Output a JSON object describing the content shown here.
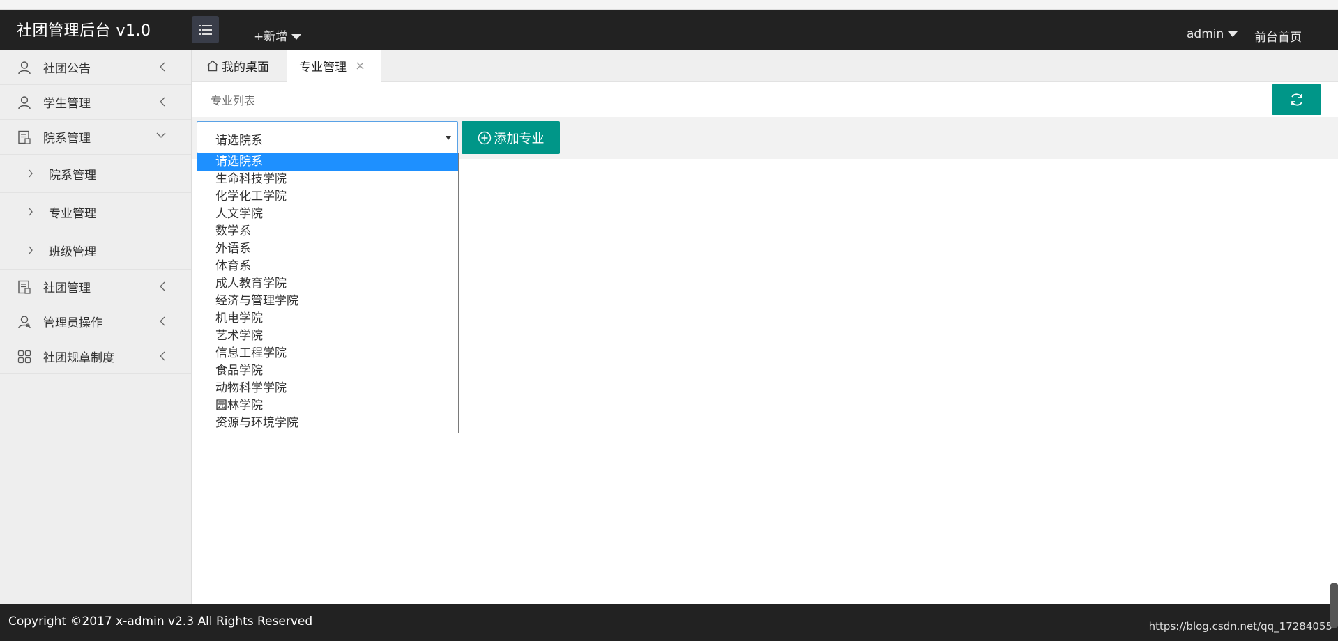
{
  "header": {
    "logo": "社团管理后台 v1.0",
    "add_new": "+新增",
    "user": "admin",
    "front_home": "前台首页"
  },
  "sidebar": {
    "items": [
      {
        "label": "社团公告",
        "icon": "user-icon"
      },
      {
        "label": "学生管理",
        "icon": "user-icon"
      },
      {
        "label": "院系管理",
        "icon": "document-icon"
      },
      {
        "label": "社团管理",
        "icon": "document-icon"
      },
      {
        "label": "管理员操作",
        "icon": "admin-user-icon"
      },
      {
        "label": "社团规章制度",
        "icon": "grid-icon"
      }
    ],
    "sub_items": [
      {
        "label": "院系管理"
      },
      {
        "label": "专业管理"
      },
      {
        "label": "班级管理"
      }
    ]
  },
  "tabs": {
    "home": "我的桌面",
    "active": "专业管理"
  },
  "breadcrumb": "专业列表",
  "toolbar": {
    "select_value": "请选院系",
    "add_button": "添加专业"
  },
  "dropdown": {
    "options": [
      "请选院系",
      "生命科技学院",
      "化学化工学院",
      "人文学院",
      "数学系",
      "外语系",
      "体育系",
      "成人教育学院",
      "经济与管理学院",
      "机电学院",
      "艺术学院",
      "信息工程学院",
      "食品学院",
      "动物科学学院",
      "园林学院",
      "资源与环境学院"
    ],
    "selected_index": 0
  },
  "footer": {
    "copyright": "Copyright ©2017 x-admin v2.3 All Rights Reserved",
    "watermark": "https://blog.csdn.net/qq_17284055"
  },
  "colors": {
    "header_bg": "#222222",
    "accent": "#009688",
    "selected": "#1e90ff"
  }
}
